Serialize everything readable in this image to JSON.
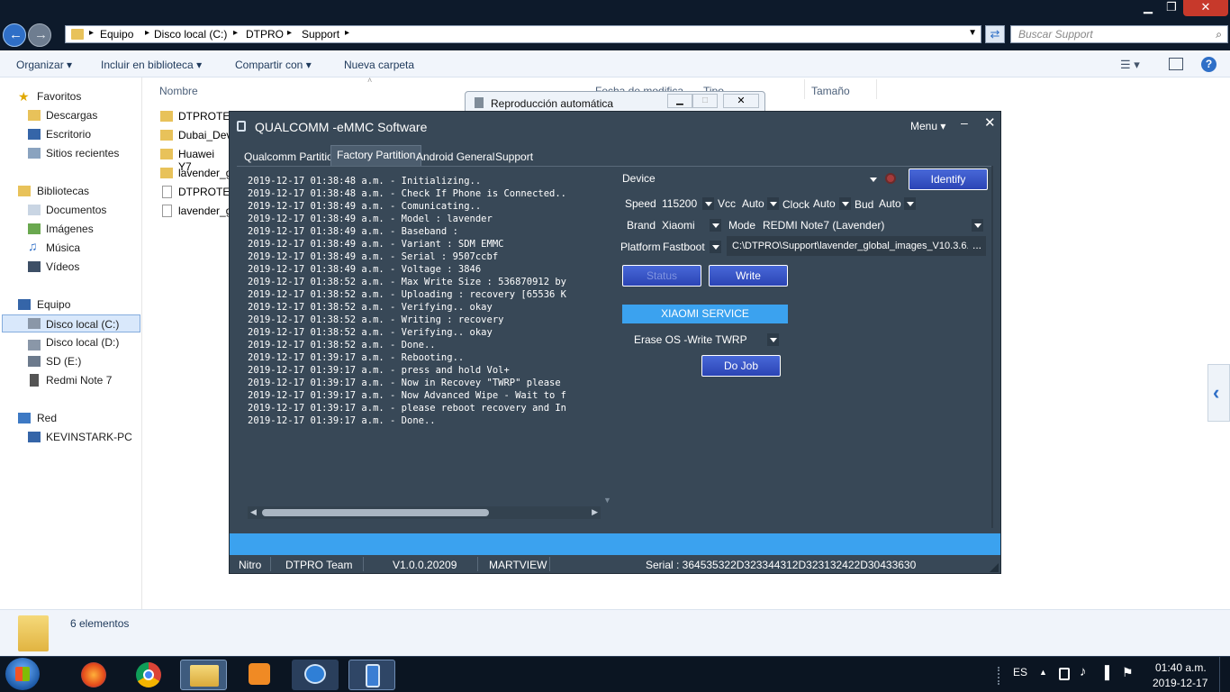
{
  "explorer": {
    "breadcrumb": [
      "Equipo",
      "Disco local (C:)",
      "DTPRO",
      "Support"
    ],
    "search_placeholder": "Buscar Support",
    "commands": [
      "Organizar",
      "Incluir en biblioteca",
      "Compartir con",
      "Nueva carpeta"
    ],
    "columns": {
      "name": "Nombre",
      "date": "Fecha de modifica...",
      "type": "Tipo",
      "size": "Tamaño"
    },
    "files": [
      "DTPROTEA",
      "Dubai_Dev",
      "Huawei Y7",
      "lavender_g",
      "DTPROTEA",
      "lavender_g"
    ],
    "nav": {
      "favorites": "Favoritos",
      "fav_items": [
        "Descargas",
        "Escritorio",
        "Sitios recientes"
      ],
      "libraries": "Bibliotecas",
      "lib_items": [
        "Documentos",
        "Imágenes",
        "Música",
        "Vídeos"
      ],
      "computer": "Equipo",
      "comp_items": [
        "Disco local (C:)",
        "Disco local (D:)",
        "SD (E:)",
        "Redmi Note 7"
      ],
      "network": "Red",
      "net_items": [
        "KEVINSTARK-PC"
      ]
    },
    "status": "6 elementos",
    "autoplay_title": "Reproducción automática"
  },
  "app": {
    "title": "QUALCOMM -eMMC Software",
    "menu": "Menu",
    "tabs": [
      "Qualcomm Partition",
      "Factory Partition",
      "Android General",
      "Support"
    ],
    "log": [
      "2019-12-17 01:38:48 a.m. - Initializing..",
      "2019-12-17 01:38:48 a.m. - Check If Phone is Connected..",
      "2019-12-17 01:38:49 a.m. - Comunicating..",
      "2019-12-17 01:38:49 a.m. - Model : lavender",
      "2019-12-17 01:38:49 a.m. - Baseband :",
      "2019-12-17 01:38:49 a.m. - Variant : SDM EMMC",
      "2019-12-17 01:38:49 a.m. - Serial : 9507ccbf",
      "2019-12-17 01:38:49 a.m. - Voltage : 3846",
      "2019-12-17 01:38:52 a.m. - Max Write Size : 536870912 by",
      "2019-12-17 01:38:52 a.m. - Uploading : recovery [65536 K",
      "2019-12-17 01:38:52 a.m. - Verifying.. okay",
      "2019-12-17 01:38:52 a.m. - Writing : recovery",
      "2019-12-17 01:38:52 a.m. - Verifying.. okay",
      "2019-12-17 01:38:52 a.m. - Done..",
      "2019-12-17 01:39:17 a.m. - Rebooting..",
      "2019-12-17 01:39:17 a.m. - press and hold Vol+",
      "2019-12-17 01:39:17 a.m. - Now in Recovey \"TWRP\" please",
      "2019-12-17 01:39:17 a.m. - Now Advanced Wipe - Wait to f",
      "2019-12-17 01:39:17 a.m. - please reboot recovery and In",
      "2019-12-17 01:39:17 a.m. - Done.."
    ],
    "device_label": "Device",
    "identify": "Identify",
    "speed_label": "Speed",
    "speed": "115200",
    "vcc_label": "Vcc",
    "vcc": "Auto",
    "clock_label": "Clock",
    "clock": "Auto",
    "bud_label": "Bud",
    "bud": "Auto",
    "brand_label": "Brand",
    "brand": "Xiaomi",
    "mode_label": "Mode",
    "mode": "REDMI Note7 (Lavender)",
    "platform_label": "Platform",
    "platform": "Fastboot",
    "path": "C:\\DTPRO\\Support\\lavender_global_images_V10.3.6.",
    "browse": "...",
    "status_btn": "Status",
    "write_btn": "Write",
    "service_header": "XIAOMI SERVICE",
    "service_option": "Erase OS -Write TWRP",
    "do_job": "Do Job",
    "footer": {
      "nitro": "Nitro",
      "team": "DTPRO Team",
      "version": "V1.0.0.20209",
      "martview": "MARTVIEW",
      "serial": "Serial : 364535322D323344312D323132422D30433630"
    }
  },
  "taskbar": {
    "lang": "ES",
    "time": "01:40 a.m.",
    "date": "2019-12-17"
  },
  "colors": {
    "app_bg": "#384857",
    "accent_blue": "#3ba2ef",
    "button_blue": "#2b44b5"
  }
}
